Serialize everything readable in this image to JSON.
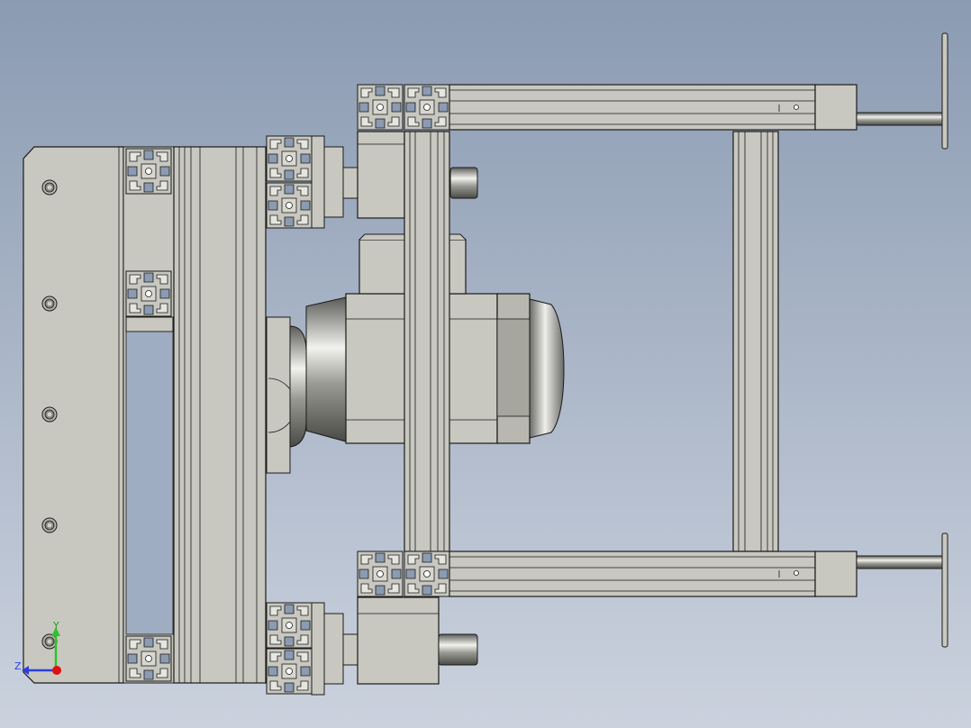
{
  "view": {
    "background_top": "#8b9bb2",
    "background_bottom": "#c9d1de",
    "part_fill": "#c8c8c0",
    "part_stroke": "#1a1a1a",
    "part_shade": "#a6a69e"
  },
  "triad": {
    "y_label": "Y",
    "z_label": "Z",
    "y_color": "#2ec22e",
    "z_color": "#2a3fd8",
    "x_color": "#e01010"
  },
  "parts": {
    "mounting_plate_holes": 5,
    "profile_icon": "aluminium-t-slot-profile-icon",
    "gearbox_icon": "gearbox-motor-icon",
    "cylinder_icon": "pneumatic-cylinder-icon"
  }
}
